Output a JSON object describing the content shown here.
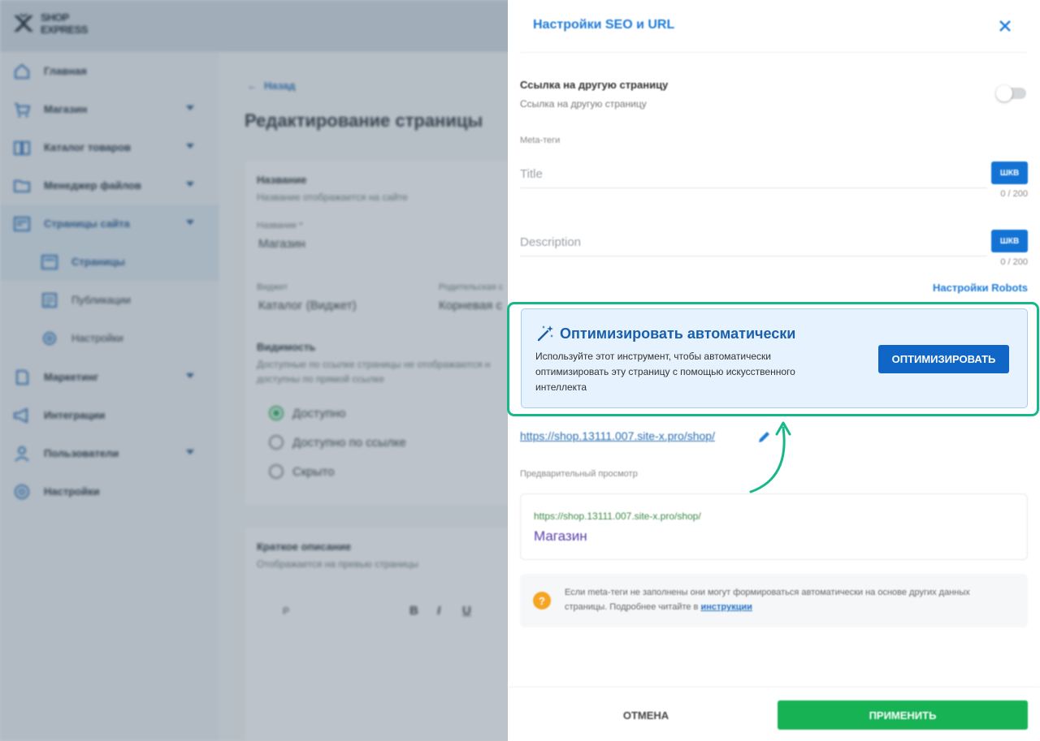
{
  "app": {
    "logo_line1": "SHOP",
    "logo_line2": "EXPRESS"
  },
  "sidebar": {
    "items": [
      {
        "label": "Главная",
        "icon": "home-icon"
      },
      {
        "label": "Магазин",
        "icon": "cart-icon"
      },
      {
        "label": "Каталог товаров",
        "icon": "catalog-icon"
      },
      {
        "label": "Менеджер файлов",
        "icon": "folder-icon"
      },
      {
        "label": "Страницы сайта",
        "icon": "pages-icon"
      },
      {
        "label": "Маркетинг",
        "icon": "marketing-icon"
      },
      {
        "label": "Интеграции",
        "icon": "megaphone-icon"
      },
      {
        "label": "Пользователи",
        "icon": "users-icon"
      },
      {
        "label": "Настройки",
        "icon": "gear-icon"
      }
    ],
    "sub_items": [
      {
        "label": "Страницы"
      },
      {
        "label": "Публикации"
      },
      {
        "label": "Настройки"
      }
    ]
  },
  "page": {
    "back": "Назад",
    "title": "Редактирование страницы",
    "name_section": {
      "title": "Название",
      "subtitle": "Название отображается на сайте",
      "field_label": "Название *",
      "value": "Магазин"
    },
    "widget": {
      "label": "Виджет",
      "value": "Каталог (Виджет)"
    },
    "parent": {
      "label": "Родительская с",
      "value": "Корневая с"
    },
    "visibility": {
      "title": "Видимость",
      "subtitle_1": "Доступные по ссылке страницы не отображаются н",
      "subtitle_2": "доступны по прямой ссылке",
      "options": [
        "Доступно",
        "Доступно по ссылке",
        "Скрыто"
      ]
    },
    "short_desc": {
      "title": "Краткое описание",
      "subtitle": "Отображается на превью страницы"
    },
    "editor": {
      "format": "P"
    }
  },
  "drawer": {
    "title": "Настройки SEO и URL",
    "link_other": {
      "title": "Ссылка на другую страницу",
      "subtitle": "Ссылка на другую страницу"
    },
    "meta_label": "Meta-теги",
    "title_field": {
      "placeholder": "Title",
      "ai_label": "ШКВ",
      "counter": "0 / 200"
    },
    "description_field": {
      "placeholder": "Description",
      "ai_label": "ШКВ",
      "counter": "0 / 200"
    },
    "robots_link": "Настройки Robots",
    "optimize": {
      "title": "Оптимизировать автоматически",
      "description": "Используйте этот инструмент, чтобы автоматически оптимизировать эту страницу с помощью искусственного интеллекта",
      "button": "ОПТИМИЗИРОВАТЬ"
    },
    "url": "https://shop.13111.007.site-x.pro/shop/",
    "preview_label": "Предварительный просмотр",
    "preview": {
      "url": "https://shop.13111.007.site-x.pro/shop/",
      "title": "Магазин"
    },
    "note": {
      "text": "Если meta-теги не заполнены они могут формироваться автоматически на основе других данных страницы. Подробнее читайте в ",
      "link": "инструкции"
    },
    "cancel": "ОТМЕНА",
    "apply": "ПРИМЕНИТЬ"
  },
  "colors": {
    "accent_green": "#16b88a",
    "primary_blue": "#0f66c6",
    "apply_green": "#16b254"
  }
}
